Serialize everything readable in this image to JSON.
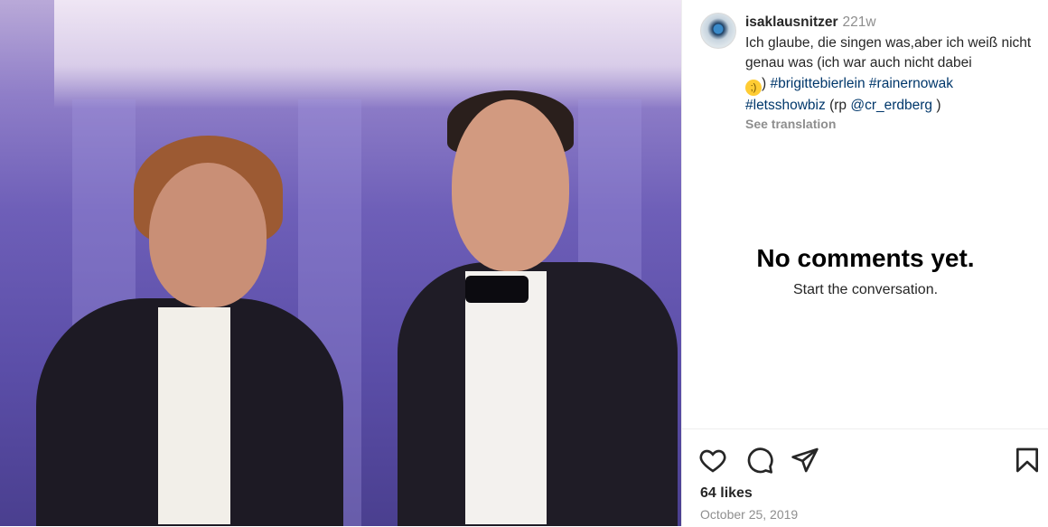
{
  "post": {
    "username": "isaklausnitzer",
    "age": "221w",
    "caption_text": "Ich glaube, die singen was,aber ich weiß nicht genau was (ich war auch nicht dabei",
    "caption_after_emoji": ")",
    "hashtags": [
      "#brigittebierlein",
      "#rainernowak",
      "#letsshowbiz"
    ],
    "credit_prefix": "(rp",
    "credit_mention": "@cr_erdberg",
    "credit_suffix": ")",
    "see_translation": "See translation"
  },
  "comments": {
    "empty_title": "No comments yet.",
    "empty_subtitle": "Start the conversation."
  },
  "actions": {
    "like_icon": "heart-icon",
    "comment_icon": "comment-icon",
    "share_icon": "share-icon",
    "save_icon": "bookmark-icon"
  },
  "stats": {
    "likes": "64 likes",
    "date": "October 25, 2019"
  },
  "colors": {
    "hashtag": "#00376b",
    "muted": "#8e8e8e",
    "text": "#262626"
  }
}
